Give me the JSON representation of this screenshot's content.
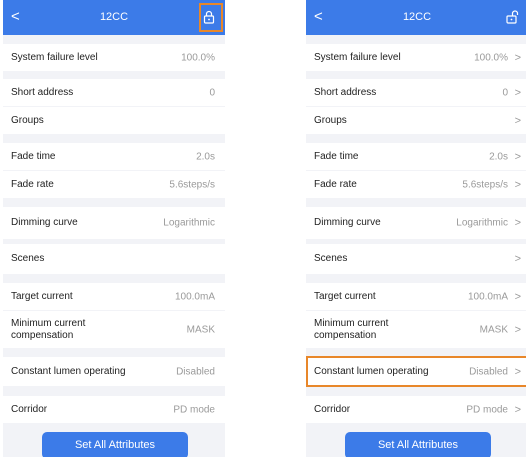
{
  "header": {
    "title": "12CC",
    "back": "<"
  },
  "rows": [
    {
      "label": "System failure level",
      "value": "100.0%"
    },
    {
      "label": "Short address",
      "value": "0"
    },
    {
      "label": "Groups",
      "value": ""
    },
    {
      "label": "Fade time",
      "value": "2.0s"
    },
    {
      "label": "Fade rate",
      "value": "5.6steps/s"
    },
    {
      "label": "Dimming curve",
      "value": "Logarithmic"
    },
    {
      "label": "Scenes",
      "value": ""
    },
    {
      "label": "Target current",
      "value": "100.0mA"
    },
    {
      "label": "Minimum current compensation",
      "value": "MASK"
    },
    {
      "label": "Constant lumen operating",
      "value": "Disabled"
    },
    {
      "label": "Corridor",
      "value": "PD mode"
    }
  ],
  "chevron": ">",
  "button_label": "Set All Attributes",
  "colors": {
    "header": "#3c7be8",
    "highlight": "#e8872a",
    "background": "#f2f3f7"
  },
  "icons": {
    "left_panel_lock": "lock-closed-icon",
    "right_panel_lock": "lock-open-icon"
  }
}
